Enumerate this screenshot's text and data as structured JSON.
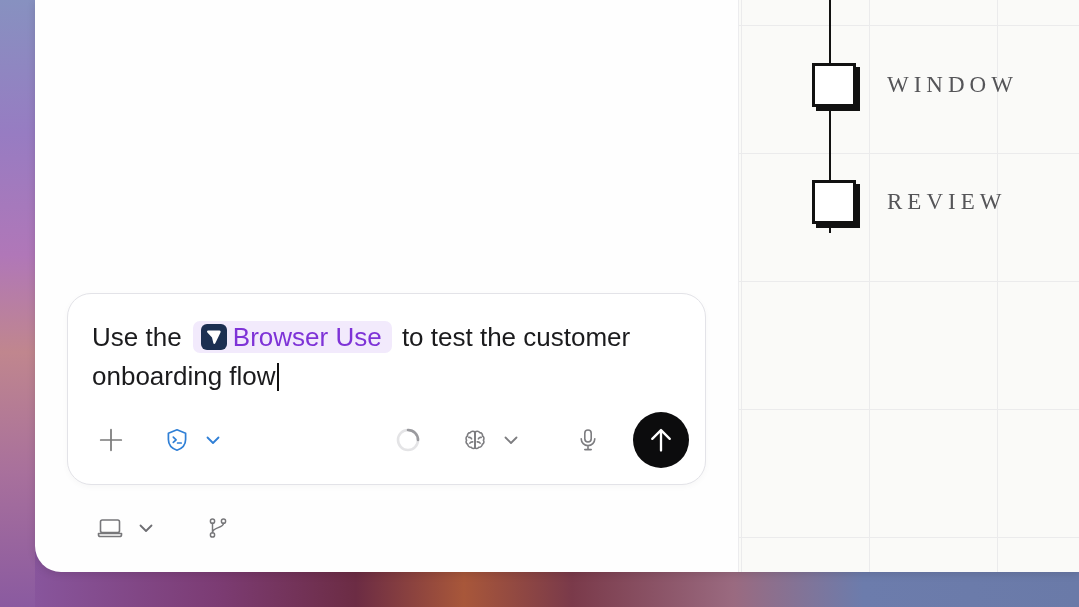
{
  "composer": {
    "text_before": "Use the",
    "chip": {
      "label": "Browser Use"
    },
    "text_after": "to test the customer onboarding flow",
    "focused": true,
    "loading": true
  },
  "canvas": {
    "steps": [
      {
        "label": "WINDOW"
      },
      {
        "label": "REVIEW"
      }
    ]
  }
}
